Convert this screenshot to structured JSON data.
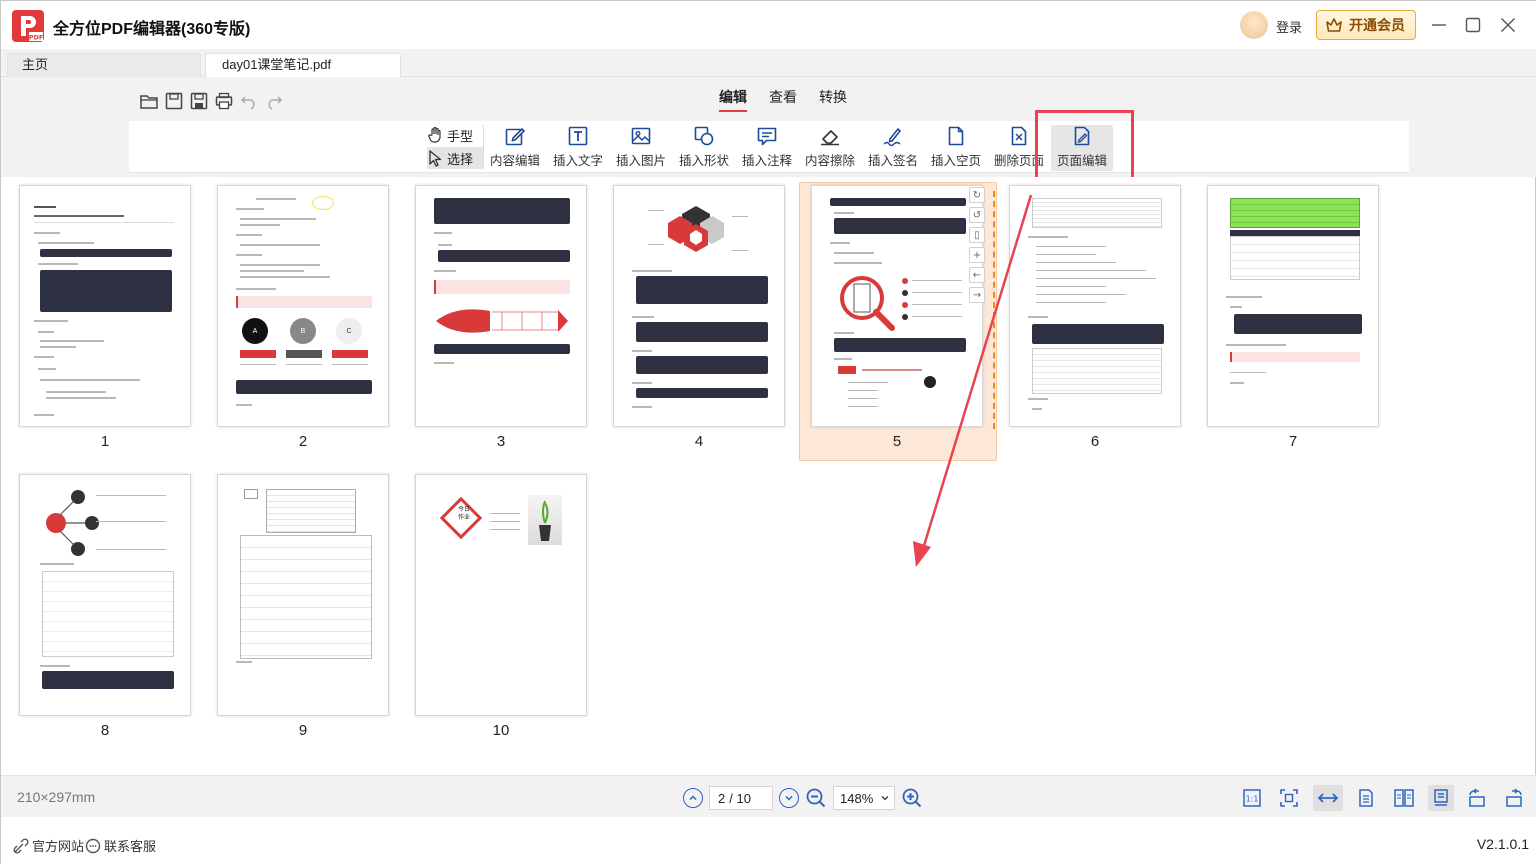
{
  "app": {
    "title": "全方位PDF编辑器(360专版)",
    "login_label": "登录",
    "vip_label": "开通会员"
  },
  "tabs": [
    {
      "label": "主页"
    },
    {
      "label": "day01课堂笔记.pdf"
    }
  ],
  "menu": {
    "tabs": [
      {
        "label": "编辑",
        "active": true
      },
      {
        "label": "查看",
        "active": false
      },
      {
        "label": "转换",
        "active": false
      }
    ]
  },
  "modes": {
    "hand_label": "手型",
    "select_label": "选择"
  },
  "ribbon": {
    "tools": [
      {
        "label": "内容编辑",
        "icon": "content-edit-icon"
      },
      {
        "label": "插入文字",
        "icon": "insert-text-icon"
      },
      {
        "label": "插入图片",
        "icon": "insert-image-icon"
      },
      {
        "label": "插入形状",
        "icon": "insert-shape-icon"
      },
      {
        "label": "插入注释",
        "icon": "insert-comment-icon"
      },
      {
        "label": "内容擦除",
        "icon": "eraser-icon"
      },
      {
        "label": "插入签名",
        "icon": "signature-icon"
      },
      {
        "label": "插入空页",
        "icon": "blank-page-icon"
      },
      {
        "label": "删除页面",
        "icon": "delete-page-icon"
      },
      {
        "label": "页面编辑",
        "icon": "page-edit-icon"
      }
    ]
  },
  "pages": [
    {
      "number": "1"
    },
    {
      "number": "2"
    },
    {
      "number": "3"
    },
    {
      "number": "4"
    },
    {
      "number": "5"
    },
    {
      "number": "6"
    },
    {
      "number": "7"
    },
    {
      "number": "8"
    },
    {
      "number": "9"
    },
    {
      "number": "10"
    }
  ],
  "selected_page": "5",
  "page_thumb_texts": {
    "p2_labels": [
      "A",
      "B",
      "C"
    ],
    "p10_title_line1": "今日",
    "p10_title_line2": "作业"
  },
  "status": {
    "dimensions": "210×297mm",
    "current_page": "2",
    "total_pages": "/ 10",
    "zoom": "148%"
  },
  "footer": {
    "official_site": "官方网站",
    "support": "联系客服",
    "version": "V2.1.0.1"
  },
  "colors": {
    "accent_red": "#e03c3c",
    "highlight_box": "#e8434e",
    "selection_bg": "#fde8d8",
    "dashed_orange": "#ee8a22",
    "status_icon_blue": "#2f64c3"
  }
}
